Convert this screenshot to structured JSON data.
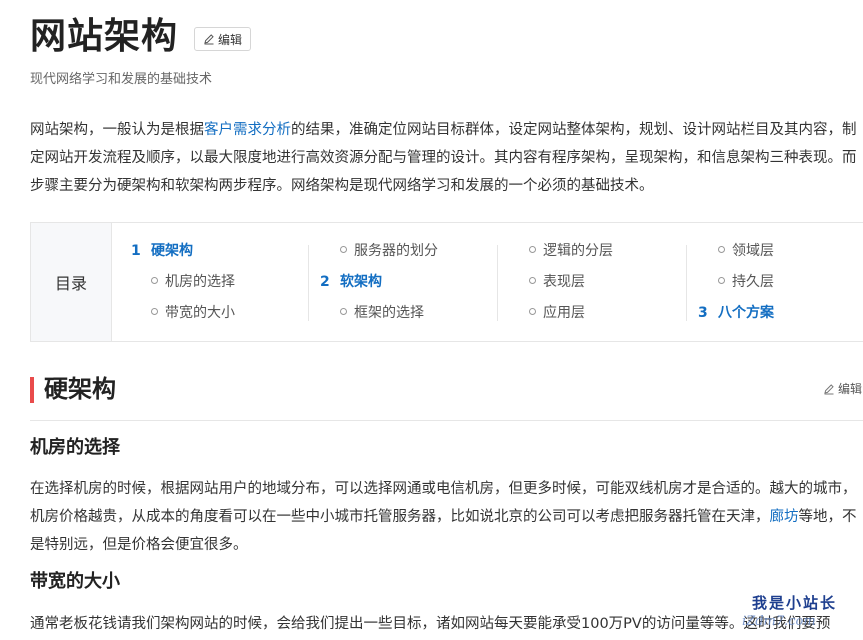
{
  "header": {
    "title": "网站架构",
    "edit_label": "编辑",
    "subtitle": "现代网络学习和发展的基础技术"
  },
  "summary": {
    "part1": "网站架构，一般认为是根据",
    "link": "客户需求分析",
    "part2": "的结果，准确定位网站目标群体，设定网站整体架构，规划、设计网站栏目及其内容，制定网站开发流程及顺序，以最大限度地进行高效资源分配与管理的设计。其内容有程序架构，呈现架构，和信息架构三种表现。而步骤主要分为硬架构和软架构两步程序。网络架构是现代网络学习和发展的一个必须的基础技术。"
  },
  "toc": {
    "label": "目录",
    "columns": [
      [
        {
          "level": 1,
          "num": "1",
          "text": "硬架构"
        },
        {
          "level": 2,
          "text": "机房的选择"
        },
        {
          "level": 2,
          "text": "带宽的大小"
        }
      ],
      [
        {
          "level": 2,
          "text": "服务器的划分"
        },
        {
          "level": 1,
          "num": "2",
          "text": "软架构"
        },
        {
          "level": 2,
          "text": "框架的选择"
        }
      ],
      [
        {
          "level": 2,
          "text": "逻辑的分层"
        },
        {
          "level": 2,
          "text": "表现层"
        },
        {
          "level": 2,
          "text": "应用层"
        }
      ],
      [
        {
          "level": 2,
          "text": "领域层"
        },
        {
          "level": 2,
          "text": "持久层"
        },
        {
          "level": 1,
          "num": "3",
          "text": "八个方案"
        }
      ]
    ]
  },
  "section1": {
    "title": "硬架构",
    "edit_label": "编辑"
  },
  "sub1": {
    "title": "机房的选择",
    "part1": "在选择机房的时候，根据网站用户的地域分布，可以选择网通或电信机房，但更多时候，可能双线机房才是合适的。越大的城市，机房价格越贵，从成本的角度看可以在一些中小城市托管服务器，比如说北京的公司可以考虑把服务器托管在天津，",
    "link": "廊坊",
    "part2": "等地，不是特别远，但是价格会便宜很多。"
  },
  "sub2": {
    "title": "带宽的大小",
    "text": "通常老板花钱请我们架构网站的时候，会给我们提出一些目标，诸如网站每天要能承受100万PV的访问量等等。这时我们要预"
  },
  "watermark": {
    "text": "我是小站长",
    "url": "iZdm7.com"
  },
  "colors": {
    "link": "#136ec2",
    "section_bar": "#e94b4b",
    "watermark": "#1e3f8f"
  },
  "icons": {
    "edit": "pencil-icon",
    "toc_bullet": "circle-bullet-icon"
  }
}
